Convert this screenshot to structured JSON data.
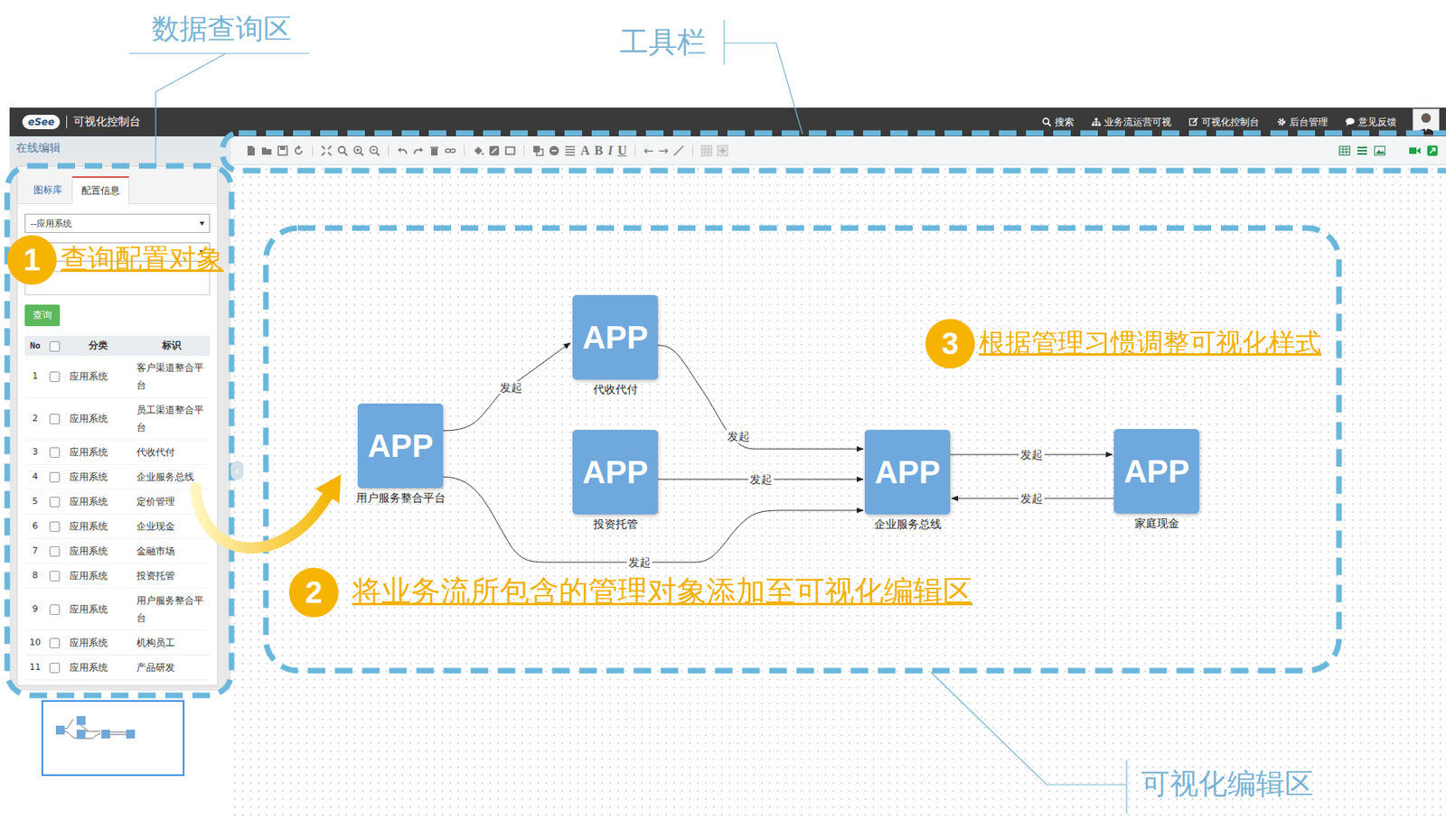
{
  "annotations": {
    "query_area": "数据查询区",
    "toolbar": "工具栏",
    "edit_area": "可视化编辑区"
  },
  "header": {
    "logo": "eSee",
    "title": "可视化控制台",
    "nav": [
      {
        "label": "搜索"
      },
      {
        "label": "业务流运营可视"
      },
      {
        "label": "可视化控制台"
      },
      {
        "label": "后台管理"
      },
      {
        "label": "意见反馈"
      }
    ]
  },
  "sidebar": {
    "bar_title": "在线编辑",
    "tabs": [
      {
        "label": "图标库",
        "selected": false
      },
      {
        "label": "配置信息",
        "selected": true
      }
    ],
    "select": "--应用系统",
    "query_button": "查询",
    "collapse": "‹"
  },
  "table": {
    "columns": [
      "No",
      "分类",
      "标识"
    ],
    "header_checked": false,
    "rows": [
      {
        "no": "1",
        "checked": false,
        "category": "应用系统",
        "name": "客户渠道整合平台"
      },
      {
        "no": "2",
        "checked": false,
        "category": "应用系统",
        "name": "员工渠道整合平台"
      },
      {
        "no": "3",
        "checked": false,
        "category": "应用系统",
        "name": "代收代付"
      },
      {
        "no": "4",
        "checked": false,
        "category": "应用系统",
        "name": "企业服务总线"
      },
      {
        "no": "5",
        "checked": false,
        "category": "应用系统",
        "name": "定价管理"
      },
      {
        "no": "6",
        "checked": false,
        "category": "应用系统",
        "name": "企业现金"
      },
      {
        "no": "7",
        "checked": false,
        "category": "应用系统",
        "name": "金融市场"
      },
      {
        "no": "8",
        "checked": false,
        "category": "应用系统",
        "name": "投资托管"
      },
      {
        "no": "9",
        "checked": false,
        "category": "应用系统",
        "name": "用户服务整合平台"
      },
      {
        "no": "10",
        "checked": false,
        "category": "应用系统",
        "name": "机构员工"
      },
      {
        "no": "11",
        "checked": false,
        "category": "应用系统",
        "name": "产品研发"
      }
    ]
  },
  "toolbar": {
    "text_tools": [
      "A",
      "B",
      "I",
      "U"
    ],
    "arrows": [
      "←",
      "→"
    ]
  },
  "diagram": {
    "nodes": [
      {
        "icon": "APP",
        "label": "用户服务整合平台"
      },
      {
        "icon": "APP",
        "label": "代收代付"
      },
      {
        "icon": "APP",
        "label": "投资托管"
      },
      {
        "icon": "APP",
        "label": "企业服务总线"
      },
      {
        "icon": "APP",
        "label": "家庭现金"
      }
    ],
    "edges": [
      {
        "from": 0,
        "to": 1,
        "label": "发起"
      },
      {
        "from": 1,
        "to": 3,
        "label": "发起"
      },
      {
        "from": 2,
        "to": 3,
        "label": "发起"
      },
      {
        "from": 0,
        "to": 3,
        "label": "发起"
      },
      {
        "from": 3,
        "to": 4,
        "label": "发起"
      },
      {
        "from": 4,
        "to": 3,
        "label": "发起"
      }
    ]
  },
  "steps": [
    {
      "number": "1",
      "text": "查询配置对象"
    },
    {
      "number": "2",
      "text": "将业务流所包含的管理对象添加至可视化编辑区"
    },
    {
      "number": "3",
      "text": "根据管理习惯调整可视化样式"
    }
  ]
}
